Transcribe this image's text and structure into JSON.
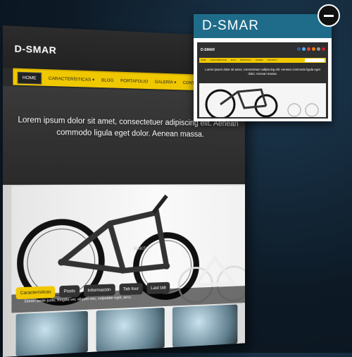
{
  "mockup": {
    "logo": "D-SMAR",
    "nav": [
      "HOME",
      "CARACTERÍSTICAS ▾",
      "BLOG",
      "PORTAFOLIO",
      "GALERÍA ▾",
      "CONTACTO"
    ],
    "tagline": "Lorem ipsum dolor sit amet, consectetuer adipiscing elit. Aenean commodo ligula eget dolor. Aenean massa.",
    "slider_caption": "Donec pede justo, fringilla vel, aliquet nec, vulputate eget, arcu.",
    "slider_brand": "RAKSO",
    "tabs": [
      "Características",
      "Posts",
      "Información",
      "Tab four",
      "Last tab"
    ]
  },
  "popup": {
    "title": "D-SMAR",
    "preview_logo": "D-SMAR",
    "preview_nav": [
      "Home",
      "Características",
      "Blog",
      "Portafolio",
      "Galería",
      "Contacto"
    ],
    "preview_tagline": "Lorem ipsum dolor sit amet, consectetuer adipiscing elit. Aenean commodo ligula eget dolor. Aenean massa."
  },
  "colors": {
    "accent": "#f0c800",
    "popup_bar": "#1e6c8a",
    "dark": "#2b2b2b"
  }
}
